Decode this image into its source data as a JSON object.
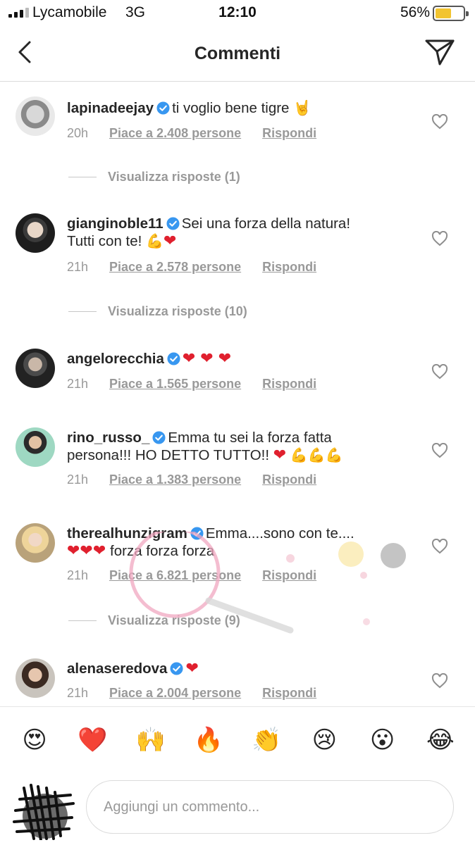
{
  "status_bar": {
    "carrier": "Lycamobile",
    "network": "3G",
    "time": "12:10",
    "battery": "56%",
    "battery_level": 0.56
  },
  "nav": {
    "title": "Commenti",
    "back_icon": "chevron-left-icon",
    "send_icon": "direct-send-icon"
  },
  "comments": [
    {
      "username": "lapinadeejay",
      "verified": true,
      "text": "ti voglio bene tigre 🤘",
      "time": "20h",
      "likes": "Piace a 2.408 persone",
      "reply": "Rispondi",
      "view_replies": "Visualizza risposte (1)"
    },
    {
      "username": "gianginoble11",
      "verified": true,
      "text_line1": "Sei una forza della natura!",
      "text_line2": "Tutti con te!",
      "time": "21h",
      "likes": "Piace a 2.578 persone",
      "reply": "Rispondi",
      "view_replies": "Visualizza risposte (10)"
    },
    {
      "username": "angelorecchia",
      "verified": true,
      "text": "",
      "time": "21h",
      "likes": "Piace a 1.565 persone",
      "reply": "Rispondi"
    },
    {
      "username": "rino_russo_",
      "verified": true,
      "text_line1": "Emma tu sei la forza fatta",
      "text_line2": "persona!!! HO DETTO TUTTO!!",
      "time": "21h",
      "likes": "Piace a 1.383 persone",
      "reply": "Rispondi"
    },
    {
      "username": "therealhunzigram",
      "verified": true,
      "text_line1": "Emma....sono con te....",
      "text_line2": "forza forza forza",
      "time": "21h",
      "likes": "Piace a 6.821 persone",
      "reply": "Rispondi",
      "view_replies": "Visualizza risposte (9)"
    },
    {
      "username": "alenaseredova",
      "verified": true,
      "text": "",
      "time": "21h",
      "likes": "Piace a 2.004 persone",
      "reply": "Rispondi"
    }
  ],
  "emoji_bar": [
    "😍",
    "❤️",
    "🙌",
    "🔥",
    "👏",
    "😢",
    "😮",
    "😂"
  ],
  "composer": {
    "placeholder": "Aggiungi un commento..."
  },
  "colors": {
    "text": "#262626",
    "secondary": "#999999",
    "verified": "#3897f0",
    "heart": "#e0202e",
    "divider": "#dbdbdb"
  }
}
